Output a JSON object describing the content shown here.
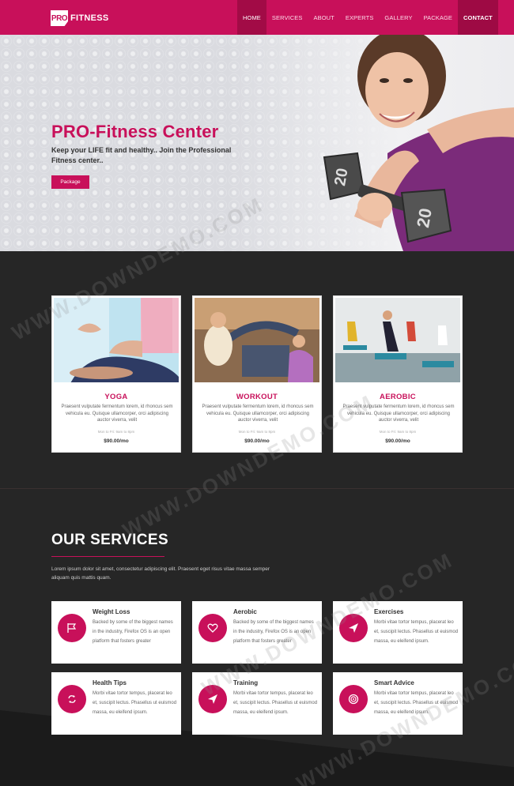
{
  "brand": {
    "badge": "PRO",
    "name": "FITNESS"
  },
  "nav": [
    "HOME",
    "SERVICES",
    "ABOUT",
    "EXPERTS",
    "GALLERY",
    "PACKAGE",
    "CONTACT"
  ],
  "hero": {
    "title": "PRO-Fitness Center",
    "subtitle": "Keep your LIFE fit and healthy.. Join the Professional Fitness center..",
    "button": "Package",
    "dumbbell_label": "20"
  },
  "classes": [
    {
      "title": "YOGA",
      "desc": "Praesent vulputate fermentum lorem, id rhoncus sem vehicula eu. Quisque ullamcorper, orci adipiscing auctor viverra, velit",
      "time": "Mon to Fri: 9am to 8pm",
      "price": "$90.00/mo"
    },
    {
      "title": "WORKOUT",
      "desc": "Praesent vulputate fermentum lorem, id rhoncus sem vehicula eu. Quisque ullamcorper, orci adipiscing auctor viverra, velit",
      "time": "Mon to Fri: 9am to 8pm",
      "price": "$90.00/mo"
    },
    {
      "title": "AEROBIC",
      "desc": "Praesent vulputate fermentum lorem, id rhoncus sem vehicula eu. Quisque ullamcorper, orci adipiscing auctor viverra, velit",
      "time": "Mon to Fri: 9am to 8pm",
      "price": "$90.00/mo"
    }
  ],
  "services": {
    "title": "OUR SERVICES",
    "intro": "Lorem ipsum dolor sit amet, consectetur adipiscing elit. Praesent eget risus vitae massa semper aliquam quis mattis quam.",
    "items": [
      {
        "title": "Weight Loss",
        "desc": "Backed by some of the biggest names in the industry, Firefox OS is an open platform that fosters greater",
        "icon": "flag-icon"
      },
      {
        "title": "Aerobic",
        "desc": "Backed by some of the biggest names in the industry, Firefox OS is an open platform that fosters greater",
        "icon": "heart-icon"
      },
      {
        "title": "Exercises",
        "desc": "Morbi vitae tortor tempus, placerat leo et, suscipit lectus. Phasellus ut euismod massa, eu eleifend ipsum.",
        "icon": "paper-plane-icon"
      },
      {
        "title": "Health Tips",
        "desc": "Morbi vitae tortor tempus, placerat leo et, suscipit lectus. Phasellus ut euismod massa, eu eleifend ipsum.",
        "icon": "refresh-icon"
      },
      {
        "title": "Training",
        "desc": "Morbi vitae tortor tempus, placerat leo et, suscipit lectus. Phasellus ut euismod massa, eu eleifend ipsum.",
        "icon": "paper-plane-icon"
      },
      {
        "title": "Smart Advice",
        "desc": "Morbi vitae tortor tempus, placerat leo et, suscipit lectus. Phasellus ut euismod massa, eu eleifend ipsum.",
        "icon": "target-icon"
      }
    ]
  },
  "watermark": "WWW.DOWNDEMO.COM",
  "colors": {
    "accent": "#c8105a",
    "dark": "#262626"
  }
}
